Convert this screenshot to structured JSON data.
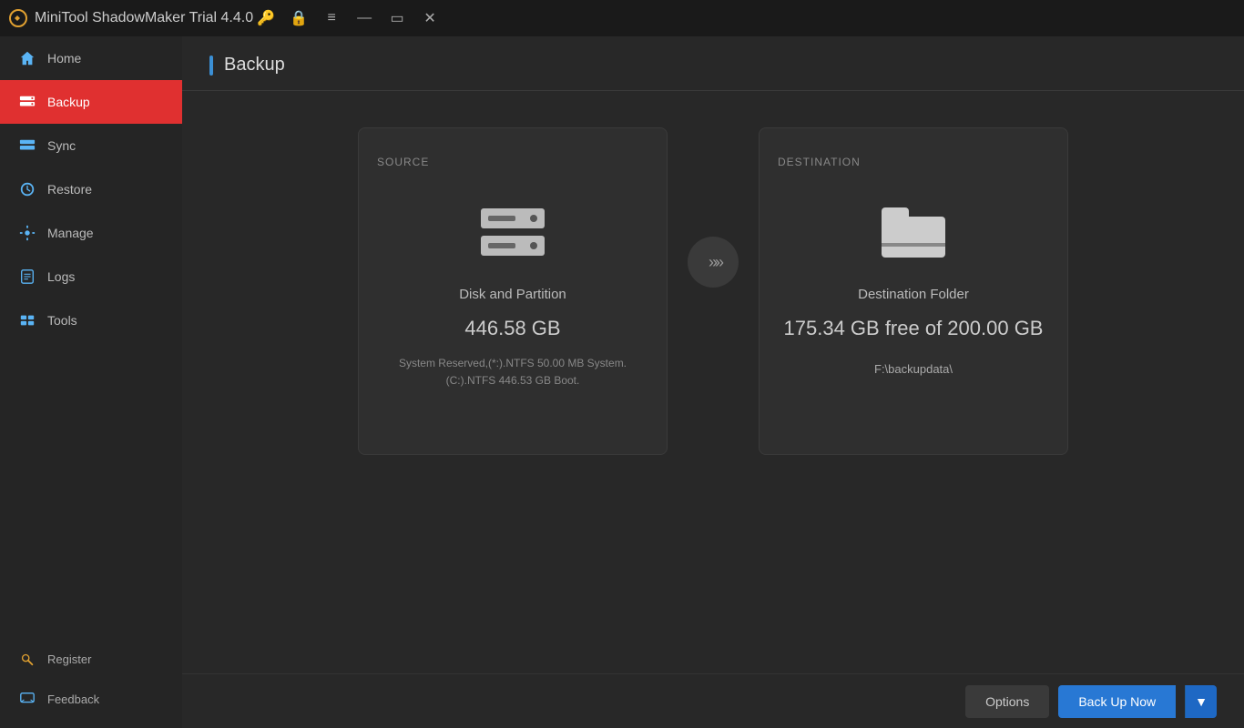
{
  "titlebar": {
    "title": "MiniTool ShadowMaker Trial 4.4.0",
    "logo": "M"
  },
  "sidebar": {
    "nav_items": [
      {
        "id": "home",
        "label": "Home",
        "active": false
      },
      {
        "id": "backup",
        "label": "Backup",
        "active": true
      },
      {
        "id": "sync",
        "label": "Sync",
        "active": false
      },
      {
        "id": "restore",
        "label": "Restore",
        "active": false
      },
      {
        "id": "manage",
        "label": "Manage",
        "active": false
      },
      {
        "id": "logs",
        "label": "Logs",
        "active": false
      },
      {
        "id": "tools",
        "label": "Tools",
        "active": false
      }
    ],
    "bottom_items": [
      {
        "id": "register",
        "label": "Register"
      },
      {
        "id": "feedback",
        "label": "Feedback"
      }
    ]
  },
  "page": {
    "title": "Backup"
  },
  "source_card": {
    "label": "SOURCE",
    "type": "Disk and Partition",
    "size": "446.58 GB",
    "details_line1": "System Reserved,(*:).NTFS 50.00 MB System.",
    "details_line2": "(C:).NTFS 446.53 GB Boot."
  },
  "destination_card": {
    "label": "DESTINATION",
    "type": "Destination Folder",
    "free": "175.34 GB free of 200.00 GB",
    "path": "F:\\backupdata\\"
  },
  "arrow": ">>>",
  "buttons": {
    "options": "Options",
    "backup_now": "Back Up Now",
    "dropdown_arrow": "▼"
  }
}
